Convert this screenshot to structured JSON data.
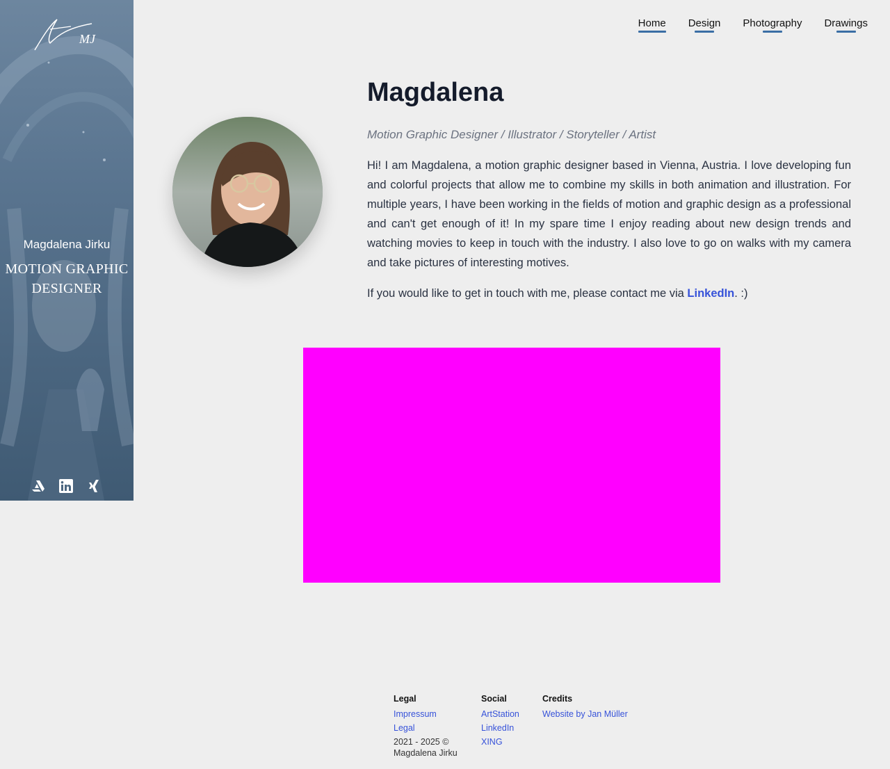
{
  "sidebar": {
    "logo_text": "MJ",
    "name": "Magdalena Jirku",
    "role": "MOTION GRAPHIC DESIGNER",
    "socials": [
      "artstation-icon",
      "linkedin-icon",
      "xing-icon"
    ]
  },
  "nav": {
    "items": [
      {
        "label": "Home"
      },
      {
        "label": "Design"
      },
      {
        "label": "Photography"
      },
      {
        "label": "Drawings"
      }
    ]
  },
  "profile": {
    "title": "Magdalena",
    "subtitle": "Motion Graphic Designer / Illustrator / Storyteller / Artist",
    "bio": "Hi! I am Magdalena, a motion graphic designer based in Vienna, Austria. I love developing fun and colorful projects that allow me to combine my skills in both animation and illustration. For multiple years, I have been working in the fields of motion and graphic design as a professional and can't get enough of it! In my spare time I enjoy reading about new design trends and watching movies to keep in touch with the industry. I also love to go on walks with my camera and take pictures of interesting motives.",
    "contact_prefix": "If you would like to get in touch with me, please contact me via ",
    "contact_link": "LinkedIn",
    "contact_suffix": ". :)"
  },
  "footer": {
    "legal": {
      "heading": "Legal",
      "impressum": "Impressum",
      "legal": "Legal",
      "copyright": "2021 - 2025 © Magdalena Jirku"
    },
    "social": {
      "heading": "Social",
      "links": [
        "ArtStation",
        "LinkedIn",
        "XING"
      ]
    },
    "credits": {
      "heading": "Credits",
      "link": "Website by Jan Müller"
    }
  },
  "colors": {
    "background": "#eeeeee",
    "accent_link": "#3652d9",
    "nav_underline": "#3a6ea5",
    "media_placeholder": "#ff00ff"
  }
}
